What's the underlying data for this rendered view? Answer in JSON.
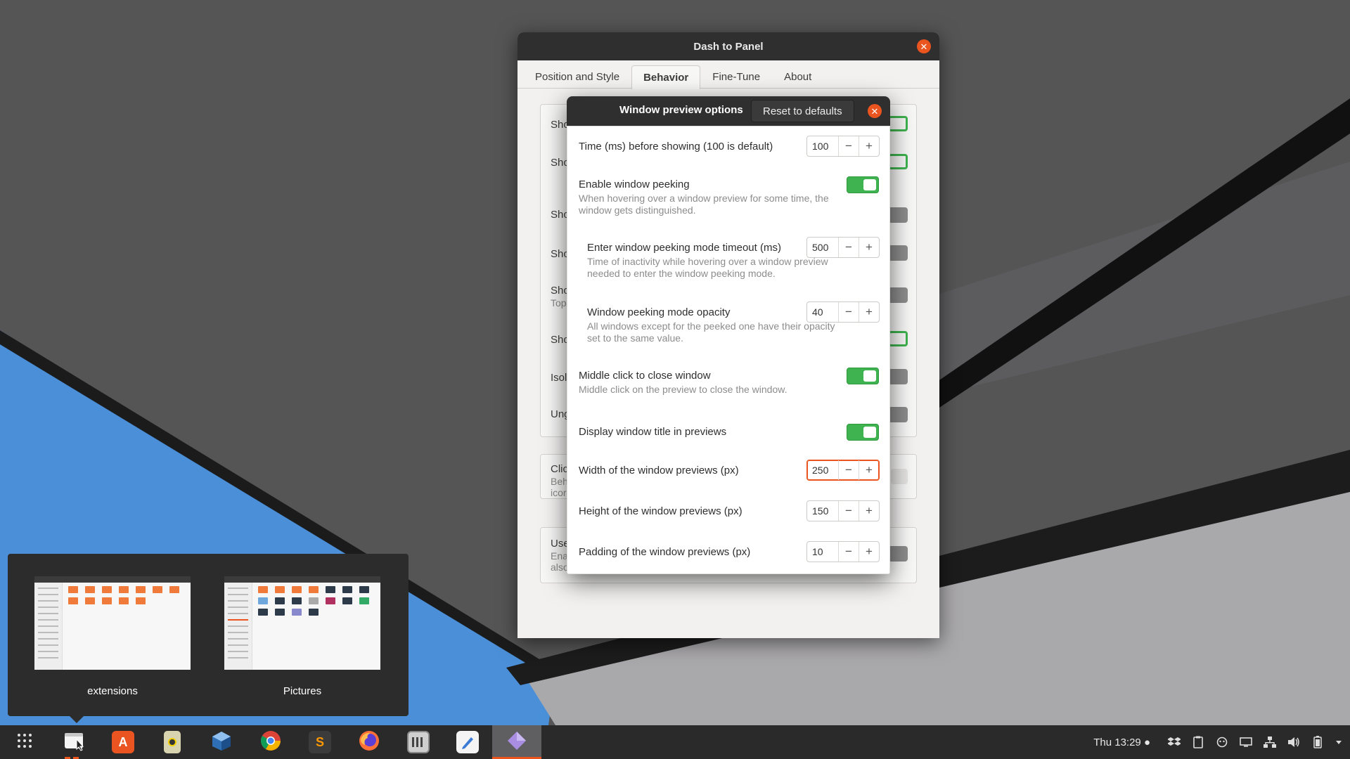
{
  "main_window": {
    "title": "Dash to Panel",
    "tabs": [
      {
        "label": "Position and Style"
      },
      {
        "label": "Behavior"
      },
      {
        "label": "Fine-Tune"
      },
      {
        "label": "About"
      }
    ],
    "bg_rows": [
      "Sho",
      "Sho",
      "Sho",
      "Sho",
      "Sho",
      "Top",
      "Sho",
      "Isol",
      "Ung",
      "Clic",
      "Beh",
      "icor",
      "Use",
      "Ena",
      "also"
    ]
  },
  "dialog": {
    "title": "Window preview options",
    "reset_label": "Reset to defaults",
    "options": {
      "time_before_showing": {
        "label": "Time (ms) before showing (100 is default)",
        "value": "100"
      },
      "enable_peeking": {
        "label": "Enable window peeking",
        "description": "When hovering over a window preview for some time, the window gets distinguished.",
        "enabled": true
      },
      "peeking_timeout": {
        "label": "Enter window peeking mode timeout (ms)",
        "value": "500",
        "description": "Time of inactivity while hovering over a window preview needed to enter the window peeking mode."
      },
      "peeking_opacity": {
        "label": "Window peeking mode opacity",
        "value": "40",
        "description": "All windows except for the peeked one have their opacity set to the same value."
      },
      "middle_click_close": {
        "label": "Middle click to close window",
        "description": "Middle click on the preview to close the window.",
        "enabled": true
      },
      "display_title": {
        "label": "Display window title in previews",
        "enabled": true
      },
      "preview_width": {
        "label": "Width of the window previews (px)",
        "value": "250"
      },
      "preview_height": {
        "label": "Height of the window previews (px)",
        "value": "150"
      },
      "preview_padding": {
        "label": "Padding of the window previews (px)",
        "value": "10"
      }
    },
    "minus_glyph": "−",
    "plus_glyph": "+",
    "close_glyph": "✕"
  },
  "preview_popup": {
    "items": [
      {
        "caption": "extensions"
      },
      {
        "caption": "Pictures"
      }
    ]
  },
  "taskbar": {
    "apps": [
      {
        "name": "show-apps",
        "icon": "grid-icon"
      },
      {
        "name": "files",
        "icon": "files-icon",
        "running": true,
        "indicator_color": "#e9541f"
      },
      {
        "name": "software",
        "icon": "ubuntu-software-icon",
        "glyph": "A"
      },
      {
        "name": "terminal-tool",
        "icon": "tool-icon"
      },
      {
        "name": "virtualbox",
        "icon": "virtualbox-icon"
      },
      {
        "name": "chrome",
        "icon": "chrome-icon"
      },
      {
        "name": "sublime",
        "icon": "sublime-text-icon",
        "glyph": "S"
      },
      {
        "name": "firefox",
        "icon": "firefox-icon"
      },
      {
        "name": "mixer",
        "icon": "mixer-icon"
      },
      {
        "name": "text-editor",
        "icon": "text-editor-icon"
      },
      {
        "name": "extension-prefs",
        "icon": "prefs-diamond-icon",
        "focused": true
      }
    ],
    "clock": "Thu 13:29 ●"
  },
  "colors": {
    "accent": "#e9541f",
    "toggle_on": "#3eb34f",
    "titlebar": "#2f2f2f",
    "taskbar": "#2a2a2a"
  }
}
